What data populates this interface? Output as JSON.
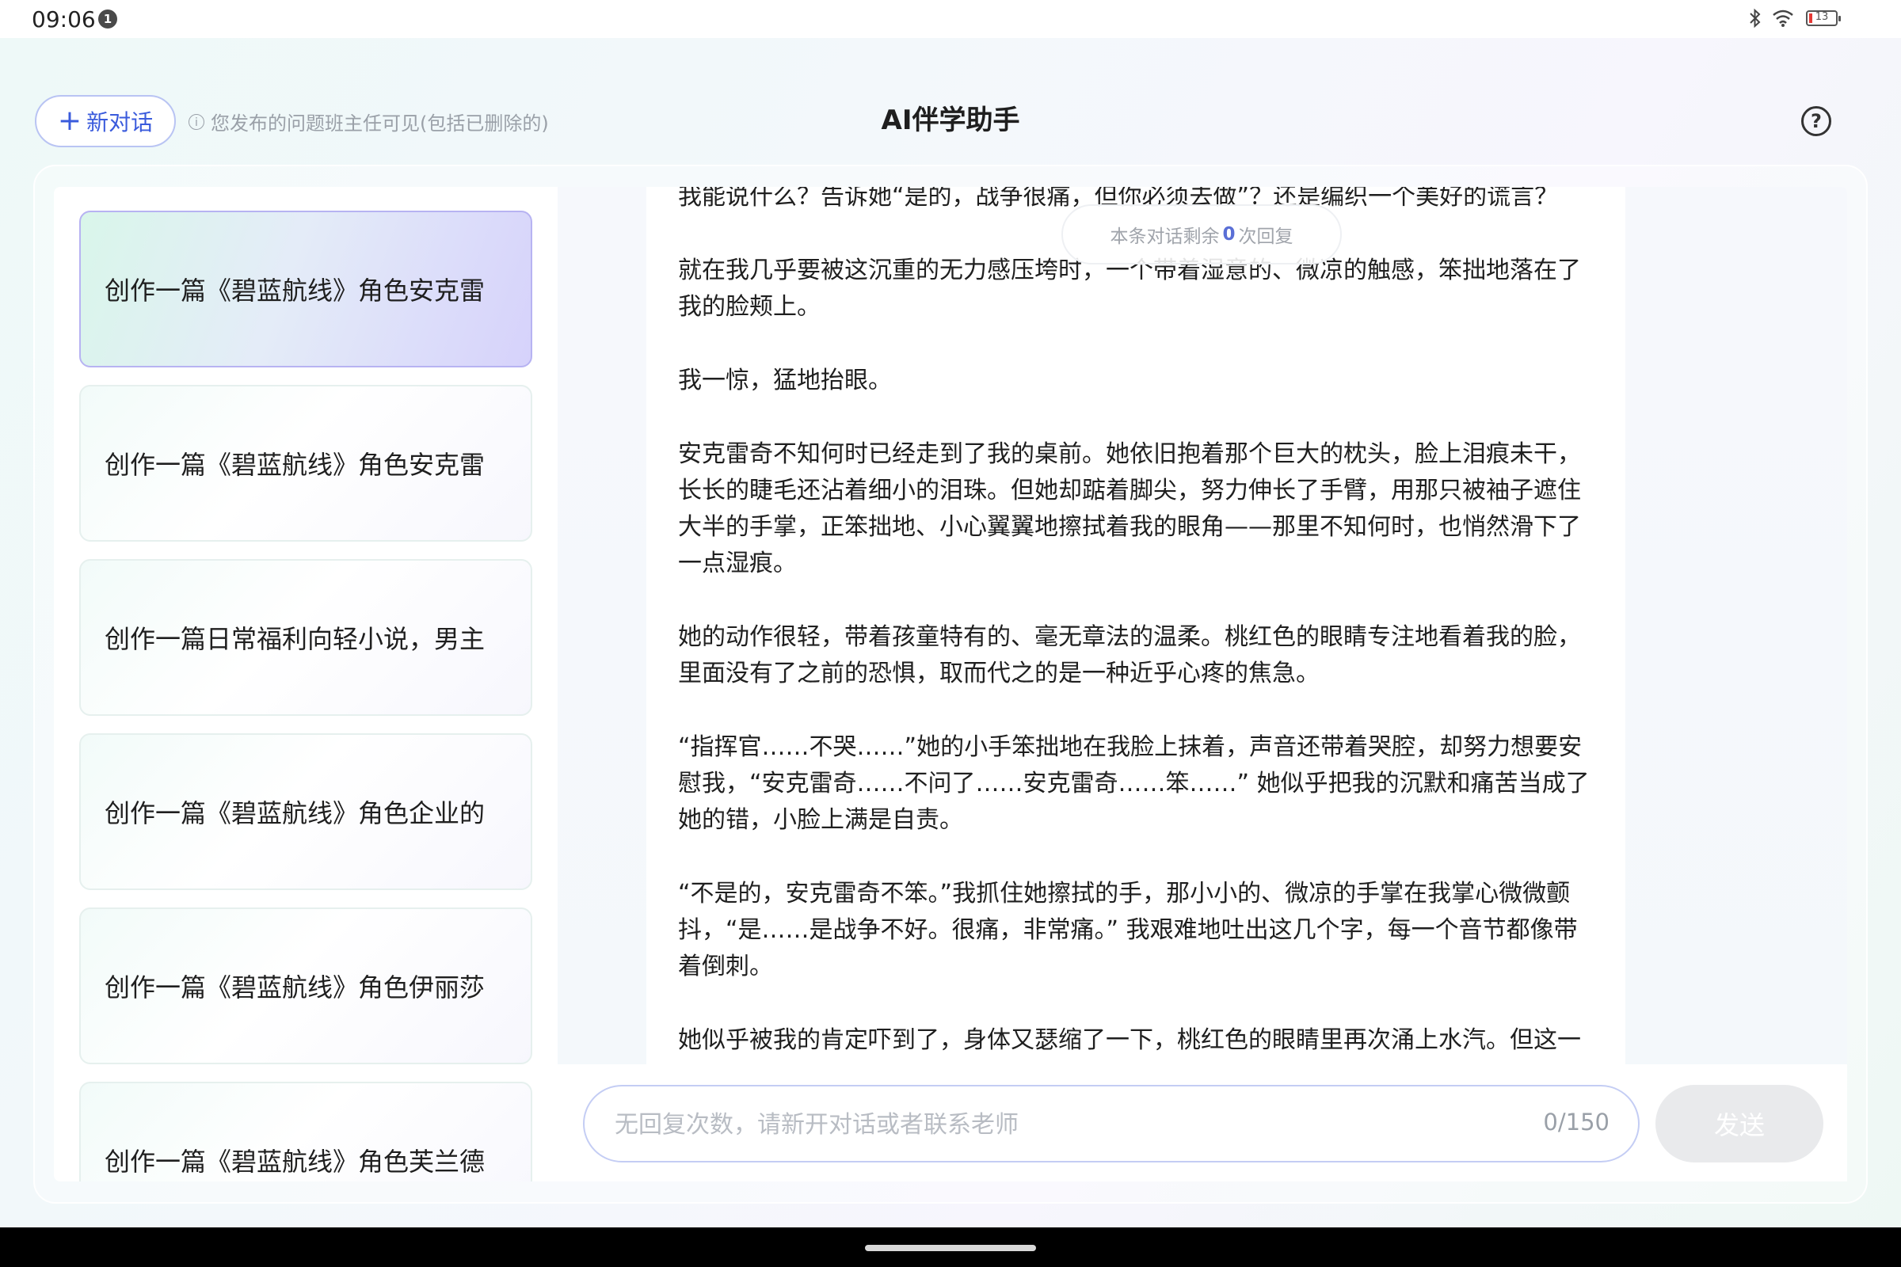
{
  "status_bar": {
    "time": "09:06",
    "notification_count": "1",
    "battery_percent": "13",
    "icons": [
      "bluetooth-icon",
      "wifi-icon",
      "battery-icon"
    ]
  },
  "header": {
    "new_chat_label": "新对话",
    "new_chat_icon": "+",
    "notice": "您发布的问题班主任可见(包括已删除的)",
    "notice_icon": "i",
    "title": "AI伴学助手",
    "help_icon": "?"
  },
  "sidebar": {
    "items": [
      {
        "label": "创作一篇《碧蓝航线》角色安克雷",
        "active": true
      },
      {
        "label": "创作一篇《碧蓝航线》角色安克雷",
        "active": false
      },
      {
        "label": "创作一篇日常福利向轻小说，男主",
        "active": false
      },
      {
        "label": "创作一篇《碧蓝航线》角色企业的",
        "active": false
      },
      {
        "label": "创作一篇《碧蓝航线》角色伊丽莎",
        "active": false
      },
      {
        "label": "创作一篇《碧蓝航线》角色芙兰德",
        "active": false
      }
    ]
  },
  "chat": {
    "remaining_prefix": "本条对话剩余",
    "remaining_count": "0",
    "remaining_suffix": "次回复",
    "paragraphs": [
      "我能说什么？告诉她“是的，战争很痛，但你必须去做”？还是编织一个美好的谎言？",
      "就在我几乎要被这沉重的无力感压垮时，一个带着湿意的、微凉的触感，笨拙地落在了我的脸颊上。",
      "我一惊，猛地抬眼。",
      "安克雷奇不知何时已经走到了我的桌前。她依旧抱着那个巨大的枕头，脸上泪痕未干，长长的睫毛还沾着细小的泪珠。但她却踮着脚尖，努力伸长了手臂，用那只被袖子遮住大半的手掌，正笨拙地、小心翼翼地擦拭着我的眼角——那里不知何时，也悄然滑下了一点湿痕。",
      "她的动作很轻，带着孩童特有的、毫无章法的温柔。桃红色的眼睛专注地看着我的脸，里面没有了之前的恐惧，取而代之的是一种近乎心疼的焦急。",
      "“指挥官……不哭……”她的小手笨拙地在我脸上抹着，声音还带着哭腔，却努力想要安慰我，“安克雷奇……不问了……安克雷奇……笨……” 她似乎把我的沉默和痛苦当成了她的错，小脸上满是自责。",
      "“不是的，安克雷奇不笨。”我抓住她擦拭的手，那小小的、微凉的手掌在我掌心微微颤抖，“是……是战争不好。很痛，非常痛。” 我艰难地吐出这几个字，每一个音节都像带着倒刺。",
      "她似乎被我的肯定吓到了，身体又瑟缩了一下，桃红色的眼睛里再次涌上水汽。但这一"
    ]
  },
  "input": {
    "placeholder": "无回复次数，请新开对话或者联系老师",
    "value": "",
    "counter": "0/150",
    "send_label": "发送"
  }
}
